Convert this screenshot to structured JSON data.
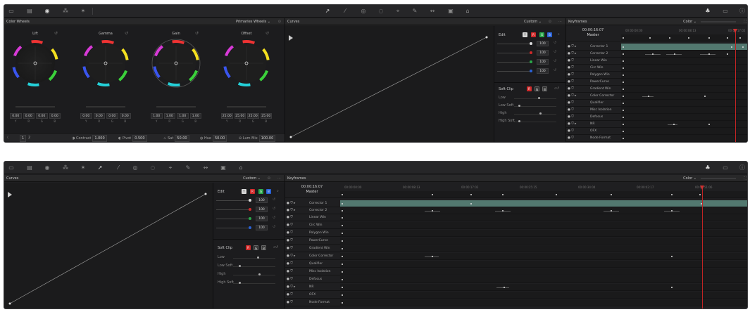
{
  "top": {
    "toolbar_icons": [
      "clips-icon",
      "lut-icon",
      "color-wheels-icon",
      "rgb-mixer-icon",
      "motion-effects-icon",
      "curves-icon",
      "color-warper-icon",
      "qualifier-icon",
      "window-icon",
      "tracker-icon",
      "magic-mask-icon",
      "blur-icon",
      "key-icon",
      "sizing-icon",
      "3d-icon",
      "scopes-icon",
      "info-icon",
      "keyframes-icon"
    ],
    "color_wheels": {
      "title": "Color Wheels",
      "mode": "Primaries Wheels",
      "wheels": [
        {
          "label": "Lift",
          "values": [
            "0.00",
            "0.00",
            "0.00",
            "0.00"
          ]
        },
        {
          "label": "Gamma",
          "values": [
            "0.00",
            "0.00",
            "0.00",
            "0.00"
          ]
        },
        {
          "label": "Gain",
          "values": [
            "1.00",
            "1.00",
            "1.00",
            "1.00"
          ]
        },
        {
          "label": "Offset",
          "values": [
            "25.00",
            "25.00",
            "25.00",
            "25.00"
          ]
        }
      ],
      "value_labels": [
        "Y",
        "R",
        "G",
        "B"
      ],
      "footer": {
        "page_a": "1",
        "page_b": "2",
        "contrast_label": "Contrast",
        "contrast_value": "1.000",
        "pivot_label": "Pivot",
        "pivot_value": "0.500",
        "sat_label": "Sat",
        "sat_value": "50.00",
        "hue_label": "Hue",
        "hue_value": "50.00",
        "lum_mix_label": "Lum Mix",
        "lum_mix_value": "100.00"
      }
    },
    "curves": {
      "title": "Curves",
      "mode": "Custom"
    },
    "edit": {
      "label": "Edit",
      "chips": [
        "Y",
        "R",
        "G",
        "B"
      ],
      "values": [
        "100",
        "100",
        "100",
        "100"
      ]
    },
    "soft_clip": {
      "label": "Soft Clip",
      "chips": [
        "R",
        "G",
        "B"
      ],
      "rows": [
        "Low",
        "Low Soft",
        "High",
        "High Soft"
      ]
    },
    "keyframes": {
      "title": "Keyframes",
      "mode": "Color",
      "timecode": "00:00:16:07",
      "master": "Master",
      "ruler": [
        "00:00:00:00",
        "00:00:08:13",
        "00:00:17:02"
      ],
      "rows": [
        "Corrector 1",
        "Corrector 2",
        "Linear Win",
        "Circ Win",
        "Polygon Win",
        "PowerCurve",
        "Gradient Win",
        "Color Corrector",
        "Qualifier",
        "Misc Isolation",
        "Defocus",
        "NR",
        "OFX",
        "Node Format"
      ]
    }
  },
  "bottom": {
    "curves": {
      "title": "Curves",
      "mode": "Custom"
    },
    "edit": {
      "label": "Edit",
      "chips": [
        "Y",
        "R",
        "G",
        "B"
      ],
      "values": [
        "100",
        "100",
        "100",
        "100"
      ]
    },
    "soft_clip": {
      "label": "Soft Clip",
      "chips": [
        "R",
        "G",
        "B"
      ],
      "rows": [
        "Low",
        "Low Soft",
        "High",
        "High Soft"
      ]
    },
    "keyframes": {
      "title": "Keyframes",
      "mode": "Color",
      "timecode": "00:00:16:07",
      "master": "Master",
      "ruler": [
        "00:00:00:00",
        "00:00:08:13",
        "00:00:17:02",
        "00:00:25:15",
        "00:00:34:04",
        "00:00:42:17",
        "00:00:51:06"
      ],
      "rows": [
        "Corrector 1",
        "Corrector 2",
        "Linear Win",
        "Circ Win",
        "Polygon Win",
        "PowerCurve",
        "Gradient Win",
        "Color Corrector",
        "Qualifier",
        "Misc Isolation",
        "Defocus",
        "NR",
        "OFX",
        "Node Format"
      ]
    }
  },
  "colors": {
    "accent_track": "#52786f",
    "playhead": "#d03030",
    "red": "#d02a2a",
    "green": "#2aa84a",
    "blue": "#2a62d6"
  }
}
